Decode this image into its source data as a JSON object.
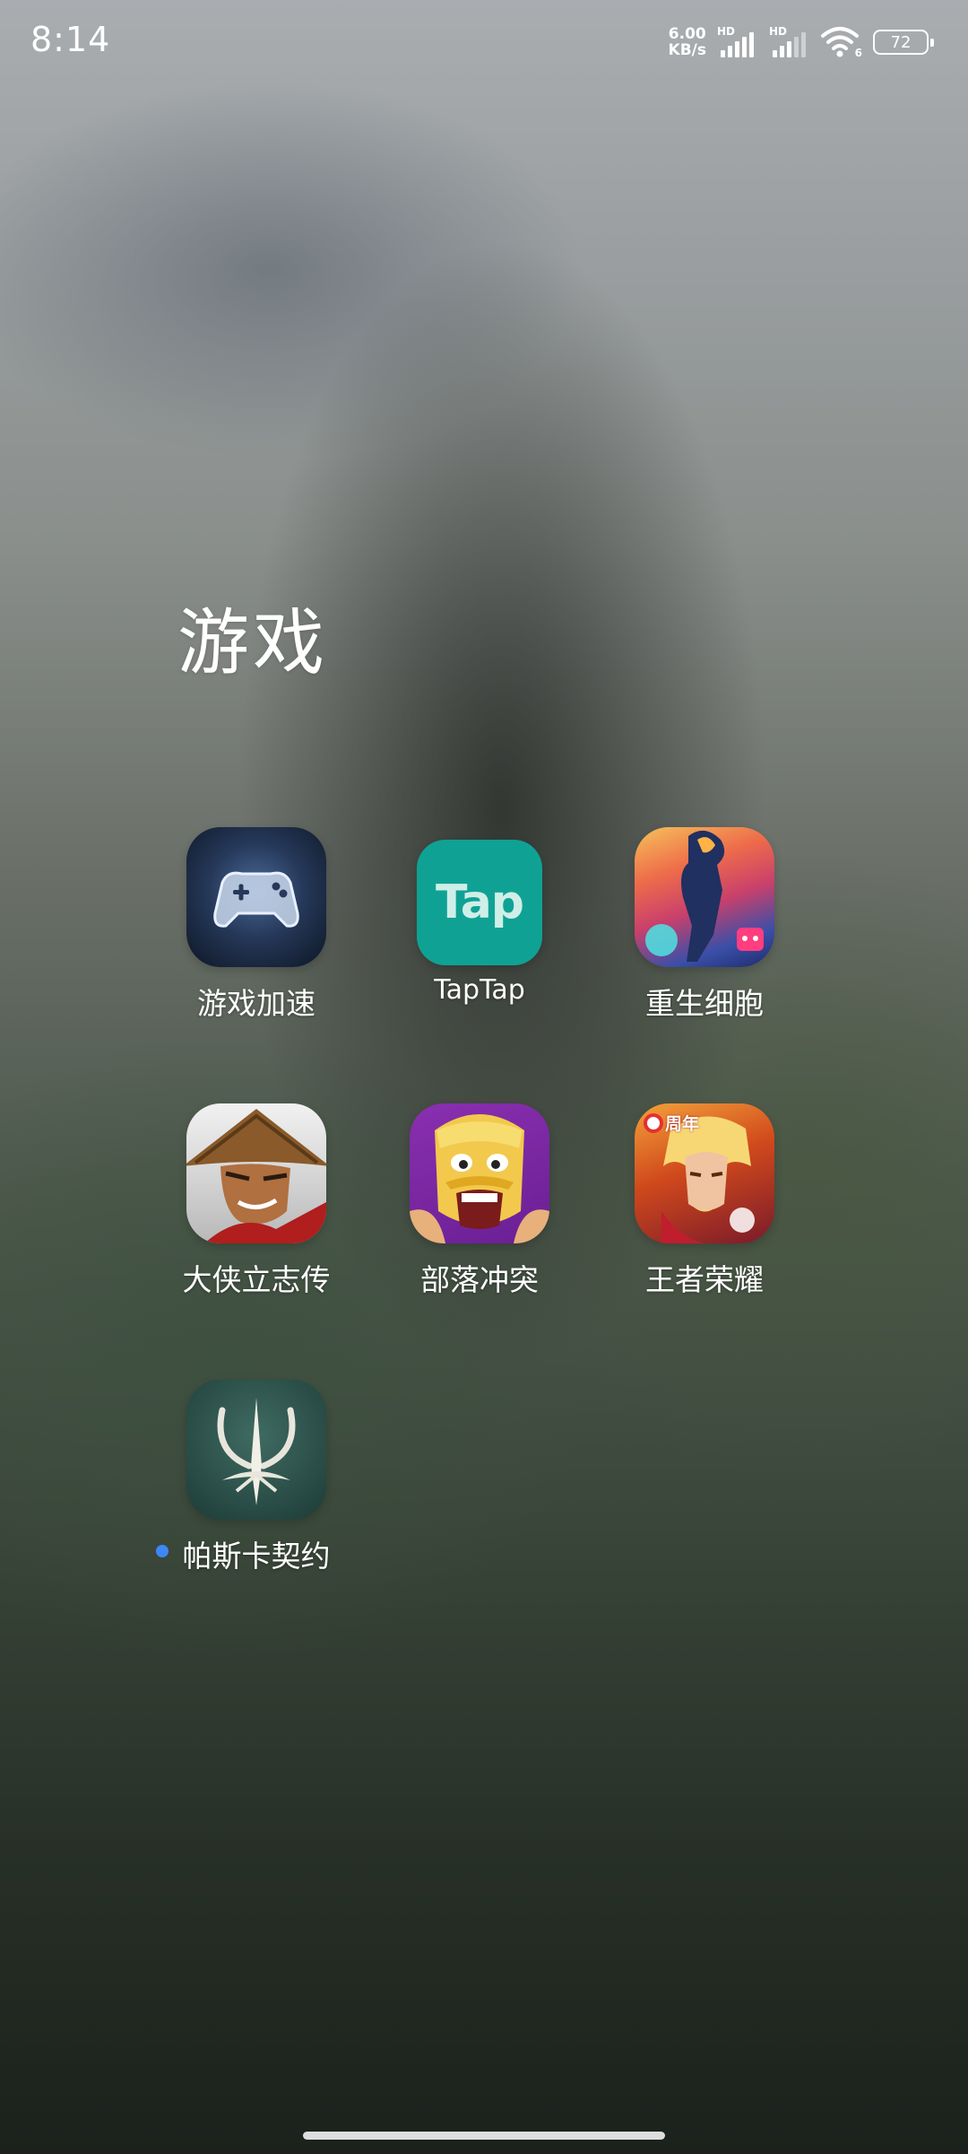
{
  "status_bar": {
    "time": "8:14",
    "net_speed_value": "6.00",
    "net_speed_unit": "KB/s",
    "sim1_label": "HD",
    "sim2_label": "HD",
    "wifi_label": "6",
    "battery_level": "72"
  },
  "folder": {
    "title": "游戏",
    "apps": [
      {
        "label": "游戏加速",
        "icon": "gamepad-icon"
      },
      {
        "label": "TapTap",
        "icon": "taptap-icon",
        "icon_text": "Tap"
      },
      {
        "label": "重生细胞",
        "icon": "dead-cells-icon"
      },
      {
        "label": "大侠立志传",
        "icon": "hero-straw-hat-icon"
      },
      {
        "label": "部落冲突",
        "icon": "clash-barbarian-icon"
      },
      {
        "label": "王者荣耀",
        "icon": "honor-of-kings-icon",
        "badge_text": "周年"
      },
      {
        "label": "帕斯卡契约",
        "icon": "pascal-emblem-icon",
        "new_indicator": true
      }
    ]
  },
  "colors": {
    "taptap": "#0fa294",
    "new_dot": "#3f86f6"
  }
}
